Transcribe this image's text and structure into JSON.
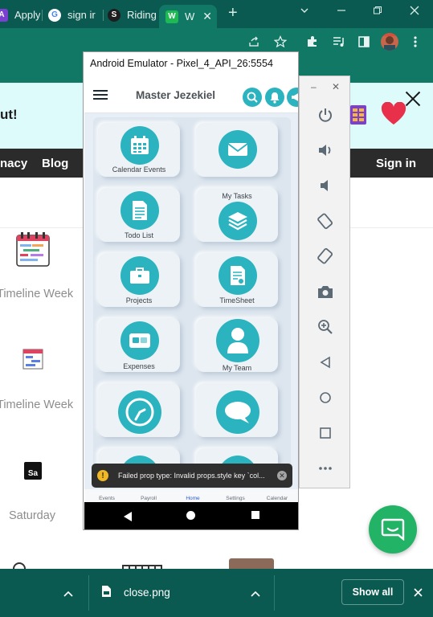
{
  "browser": {
    "tabs": [
      {
        "title": "Apply",
        "favicon": "A"
      },
      {
        "title": "sign ir",
        "favicon": "G"
      },
      {
        "title": "Riding",
        "favicon": "S"
      },
      {
        "title": "W",
        "favicon": "W"
      }
    ],
    "new_tab": "+",
    "colors": {
      "tabstrip": "#0b5a52",
      "toolbar": "#117866"
    }
  },
  "website": {
    "banner_fragment": "ut!",
    "nav": {
      "privacy_fragment": "nacy",
      "blog": "Blog",
      "sign_in": "Sign in"
    },
    "views": [
      {
        "label": "Timeline Week",
        "icon": "timeline-week-color-icon"
      },
      {
        "label": "Timeline Week",
        "icon": "timeline-week-grid-icon"
      },
      {
        "label": "Saturday",
        "icon": "calendar-sa-icon",
        "badge": "Sa"
      }
    ]
  },
  "emulator": {
    "title": "Android Emulator - Pixel_4_API_26:5554",
    "app": {
      "title": "Master Jezekiel",
      "tiles": [
        {
          "label": "Calendar Events",
          "icon": "calendar-icon"
        },
        {
          "label": "",
          "icon": "mail-icon"
        },
        {
          "label": "Todo List",
          "icon": "document-icon"
        },
        {
          "label": "My Tasks",
          "icon": "layers-icon"
        },
        {
          "label": "Projects",
          "icon": "briefcase-icon"
        },
        {
          "label": "TimeSheet",
          "icon": "timesheet-icon"
        },
        {
          "label": "Expenses",
          "icon": "card-icon"
        },
        {
          "label": "My Team",
          "icon": "person-icon"
        },
        {
          "label": "",
          "icon": "clock-icon"
        },
        {
          "label": "",
          "icon": "chat-icon"
        }
      ],
      "toast": "Failed prop type: Invalid props.style key `col...",
      "bottom_tabs": [
        "Events",
        "Payroll",
        "Home",
        "Settings",
        "Calendar"
      ],
      "active_tab": "Home",
      "accent": "#2bb4bf"
    },
    "side_panel": [
      "power",
      "volume-up",
      "volume-down",
      "rotate-left",
      "rotate-right",
      "camera",
      "zoom",
      "back",
      "home",
      "overview",
      "more"
    ]
  },
  "downloads": {
    "file": "close.png",
    "show_all": "Show all"
  }
}
